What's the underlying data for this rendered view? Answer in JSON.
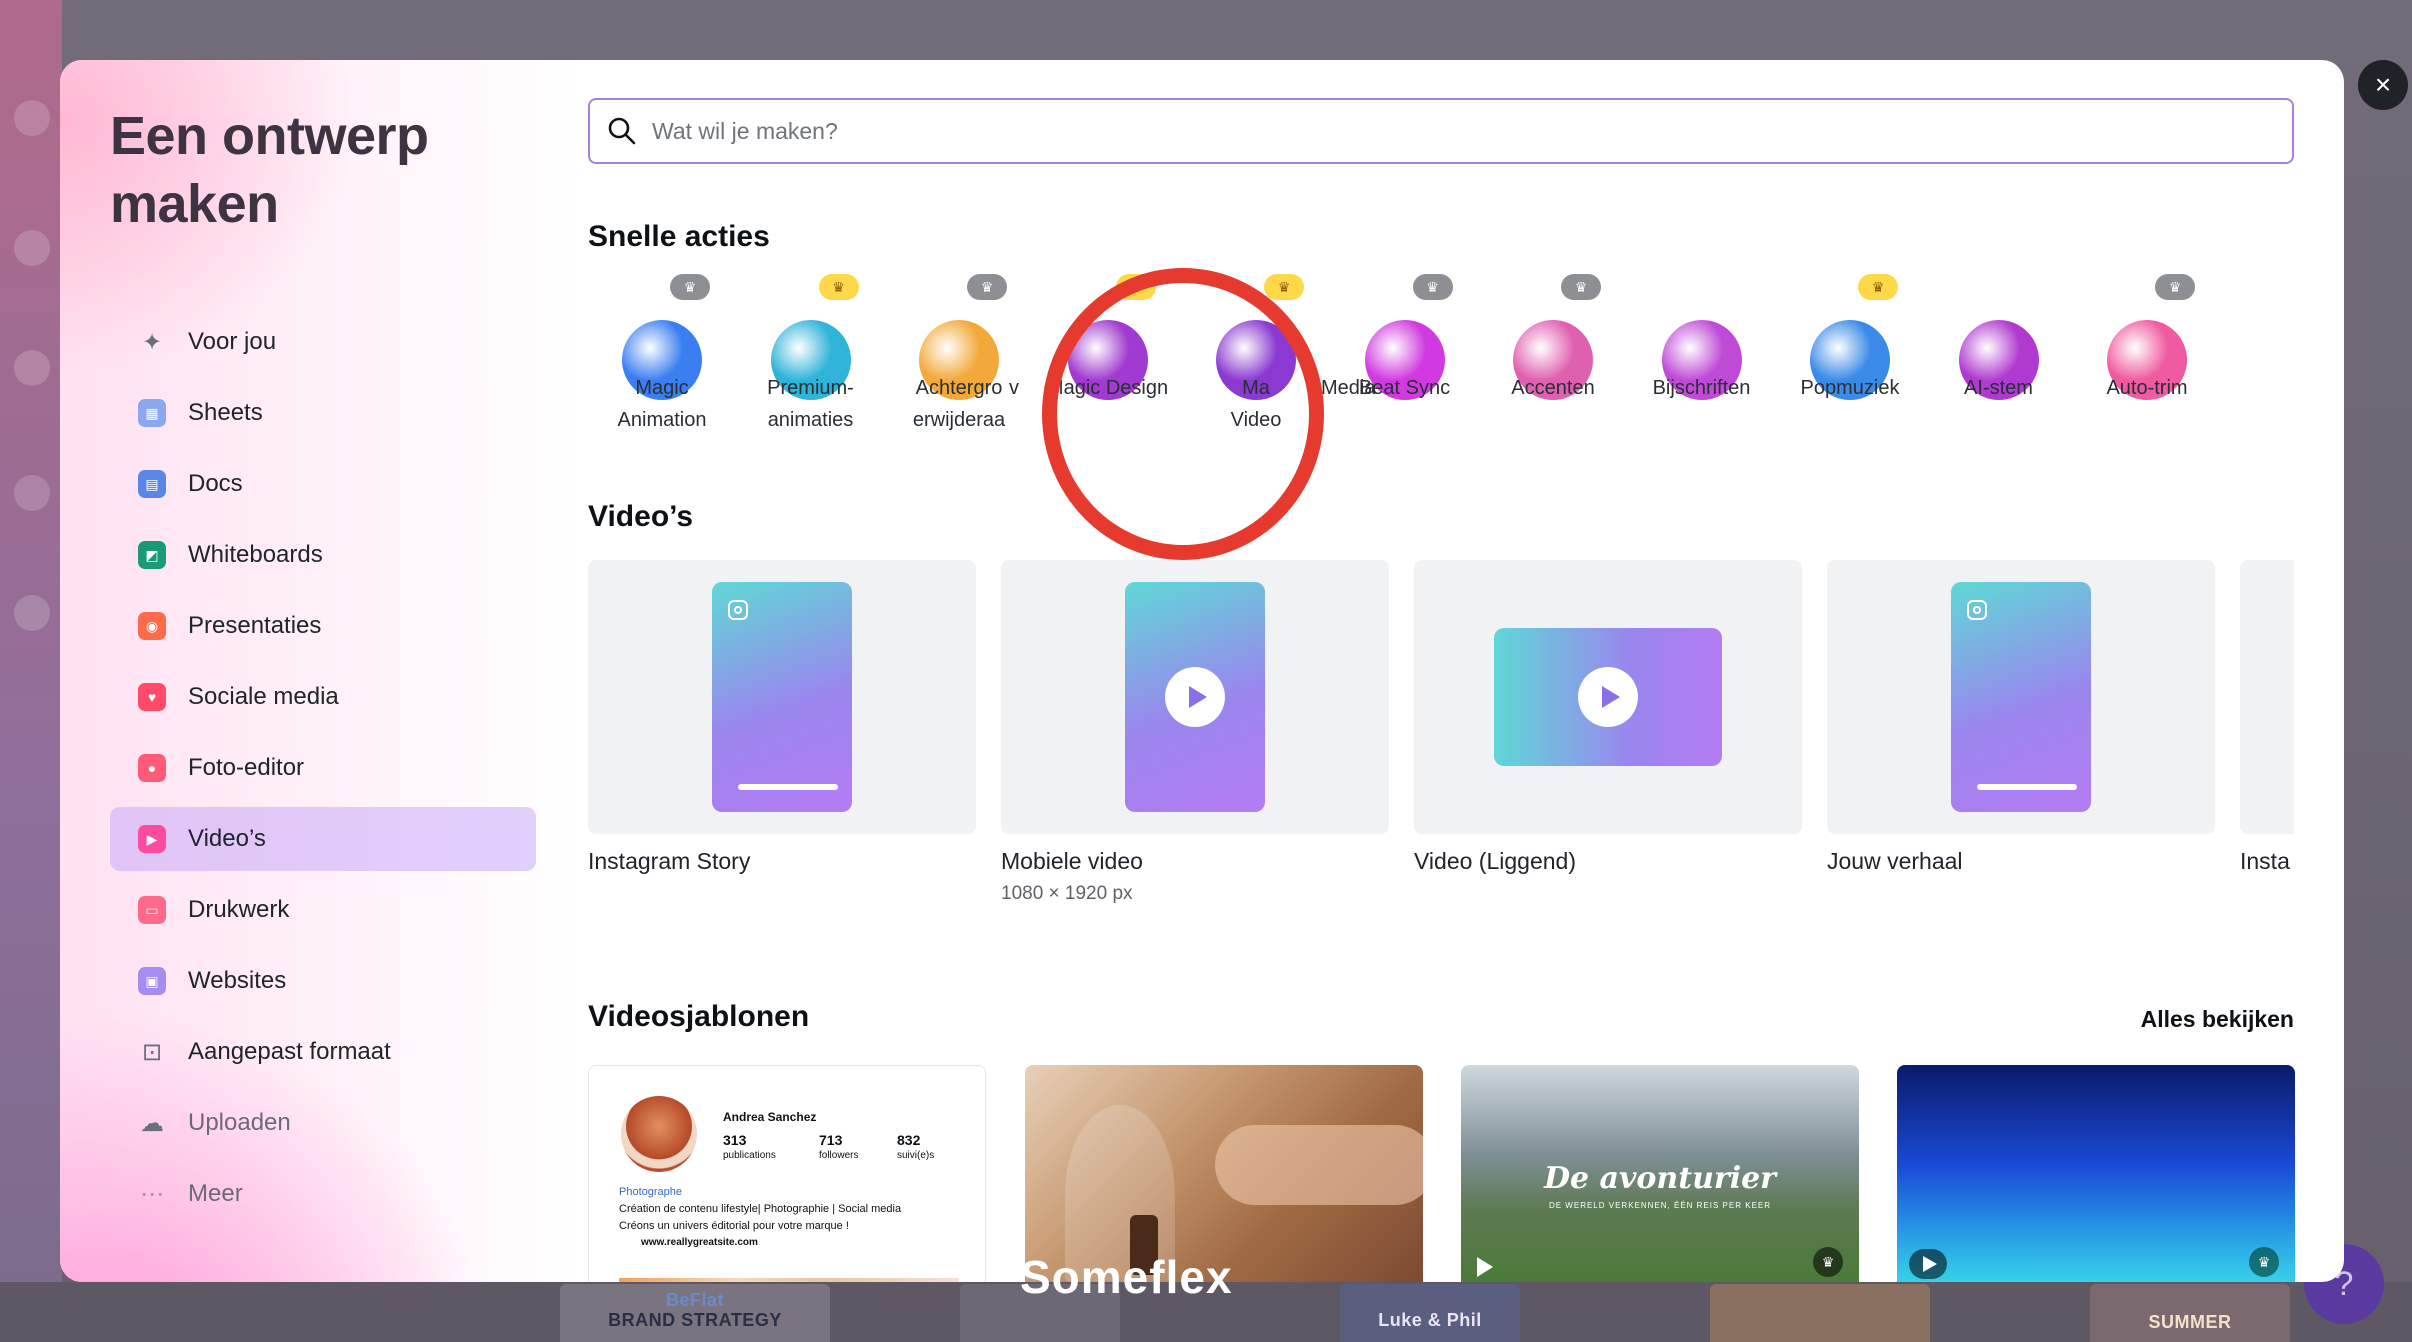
{
  "modal": {
    "title": "Een ontwerp maken",
    "close_label": "×"
  },
  "nav": {
    "items": [
      {
        "label": "Voor jou",
        "icon": "sparkle-icon",
        "color": "#6b6f78"
      },
      {
        "label": "Sheets",
        "icon": "sheets-icon",
        "color": "#8aa7ef"
      },
      {
        "label": "Docs",
        "icon": "docs-icon",
        "color": "#5a86e8"
      },
      {
        "label": "Whiteboards",
        "icon": "whiteboard-icon",
        "color": "#1b9a78"
      },
      {
        "label": "Presentaties",
        "icon": "presentation-icon",
        "color": "#ff6b4a"
      },
      {
        "label": "Sociale media",
        "icon": "heart-icon",
        "color": "#ff4a6a"
      },
      {
        "label": "Foto-editor",
        "icon": "camera-icon",
        "color": "#ff5a78"
      },
      {
        "label": "Video’s",
        "icon": "video-icon",
        "color": "#ff4aa0"
      },
      {
        "label": "Drukwerk",
        "icon": "printer-icon",
        "color": "#ff6a8a"
      },
      {
        "label": "Websites",
        "icon": "website-icon",
        "color": "#a58cf0"
      },
      {
        "label": "Aangepast formaat",
        "icon": "custom-size-icon",
        "color": "#6b6f78"
      },
      {
        "label": "Uploaden",
        "icon": "cloud-upload-icon",
        "color": "#6b6f78"
      },
      {
        "label": "Meer",
        "icon": "more-icon",
        "color": "#9c98a3"
      }
    ]
  },
  "search": {
    "placeholder": "Wat wil je maken?"
  },
  "quick_actions": {
    "title": "Snelle acties",
    "items": [
      {
        "label": "Magic Animation",
        "crown": "grey",
        "color": "#3a7ef2"
      },
      {
        "label": "Premium-animaties",
        "crown": "gold",
        "color": "#2fb3d9"
      },
      {
        "label": "Achtergrondvideo verwijderaar",
        "crown": "grey",
        "color": "#f2a93a"
      },
      {
        "label": "Magic Design",
        "crown": "gold",
        "color": "#a03ad0"
      },
      {
        "label": "Magic Media Video",
        "crown": "gold",
        "color": "#8a3ad0"
      },
      {
        "label": "Beat Sync",
        "crown": "grey",
        "color": "#d13ae0"
      },
      {
        "label": "Accenten",
        "crown": "grey",
        "color": "#e060b0"
      },
      {
        "label": "Bijschriften",
        "crown": "none",
        "color": "#c04ad8"
      },
      {
        "label": "Popmuziek",
        "crown": "gold",
        "color": "#3a8ae8"
      },
      {
        "label": "AI-stem",
        "crown": "none",
        "color": "#b03ad0"
      },
      {
        "label": "Auto-trim",
        "crown": "grey",
        "color": "#f05aa0"
      }
    ],
    "label_lines": [
      [
        "Magic",
        "Animation"
      ],
      [
        "Premium-",
        "animaties"
      ],
      [
        "Achtergro",
        "erwijderaa"
      ],
      [
        "Magic Design",
        ""
      ],
      [
        "Ma",
        "Video"
      ],
      [
        "Beat Sync",
        ""
      ],
      [
        "Accenten",
        ""
      ],
      [
        "Bijschriften",
        ""
      ],
      [
        "Popmuziek",
        ""
      ],
      [
        "AI-stem",
        ""
      ],
      [
        "Auto-trim",
        ""
      ]
    ],
    "label_fragments": {
      "ach_tail": "v",
      "mm_tail": "Media"
    }
  },
  "videos": {
    "title": "Video’s",
    "cards": [
      {
        "label": "Instagram Story",
        "sub": ""
      },
      {
        "label": "Mobiele video",
        "sub": "1080 × 1920 px"
      },
      {
        "label": "Video (Liggend)",
        "sub": ""
      },
      {
        "label": "Jouw verhaal",
        "sub": ""
      },
      {
        "label": "Insta",
        "sub": ""
      }
    ]
  },
  "templates": {
    "title": "Videosjablonen",
    "see_all": "Alles bekijken",
    "profile": {
      "name": "Andrea Sanchez",
      "stats": [
        {
          "value": "313",
          "label": "publications"
        },
        {
          "value": "713",
          "label": "followers"
        },
        {
          "value": "832",
          "label": "suivi(e)s"
        }
      ],
      "role": "Photographe",
      "bio1": "Création de contenu lifestyle| Photographie | Social media",
      "bio2": "Créons un univers éditorial pour votre marque !",
      "link": "www.reallygreatsite.com"
    },
    "landscape_title": "De avonturier",
    "landscape_sub": "DE WERELD VERKENNEN, ÉÉN REIS PER KEER"
  },
  "backdrop": {
    "brand_a": "BeFlat",
    "brand_b": "BRAND STRATEGY",
    "thumb2": "Luke & Phil",
    "thumb3": "SUMMER",
    "help": "?"
  },
  "watermark": "Someflex"
}
